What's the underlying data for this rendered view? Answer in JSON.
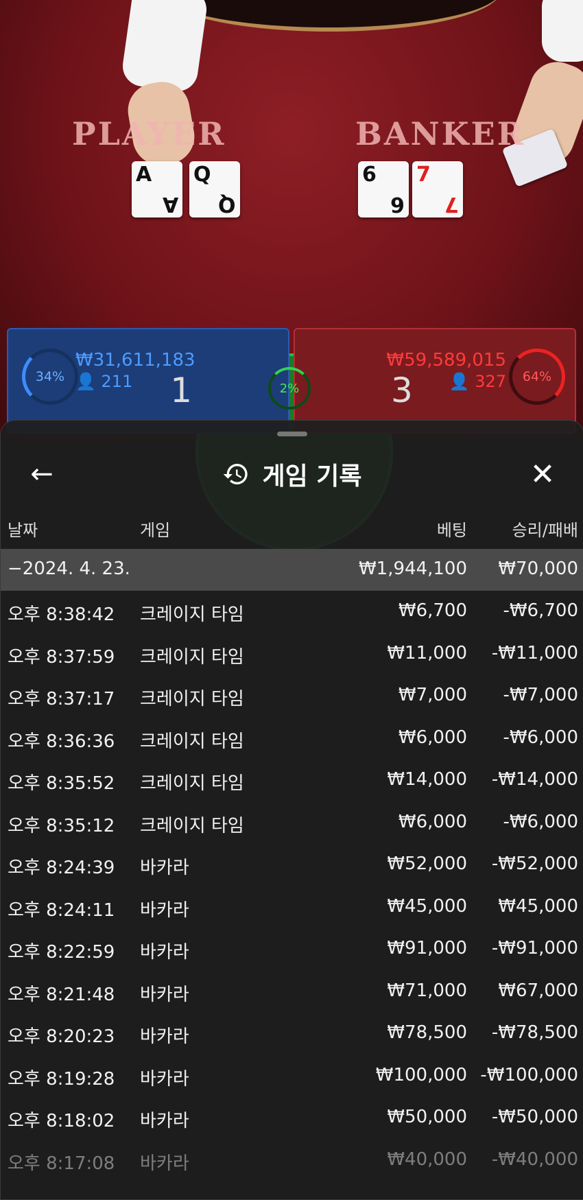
{
  "table": {
    "player_label": "PLAYER",
    "banker_label": "BANKER",
    "player_cards": [
      {
        "rank": "A",
        "suit": "♠",
        "color": "black"
      },
      {
        "rank": "Q",
        "suit": "♠",
        "color": "black"
      }
    ],
    "banker_cards": [
      {
        "rank": "6",
        "suit": "♠",
        "color": "black"
      },
      {
        "rank": "7",
        "suit": "♥",
        "color": "red"
      }
    ]
  },
  "bets": {
    "player": {
      "percent": "34%",
      "amount": "₩31,611,183",
      "count": "211",
      "score": "1"
    },
    "tie": {
      "percent": "2%"
    },
    "banker": {
      "percent": "64%",
      "amount": "₩59,589,015",
      "count": "327",
      "score": "3"
    }
  },
  "history": {
    "title": "게임 기록",
    "columns": {
      "date": "날짜",
      "game": "게임",
      "bet": "베팅",
      "winloss": "승리/패배"
    },
    "date_group": {
      "date": "−2024. 4. 23.",
      "bet": "₩1,944,100",
      "winloss": "₩70,000"
    },
    "rows": [
      {
        "time": "오후 8:38:42",
        "game": "크레이지 타임",
        "bet": "₩6,700",
        "winloss": "-₩6,700"
      },
      {
        "time": "오후 8:37:59",
        "game": "크레이지 타임",
        "bet": "₩11,000",
        "winloss": "-₩11,000"
      },
      {
        "time": "오후 8:37:17",
        "game": "크레이지 타임",
        "bet": "₩7,000",
        "winloss": "-₩7,000"
      },
      {
        "time": "오후 8:36:36",
        "game": "크레이지 타임",
        "bet": "₩6,000",
        "winloss": "-₩6,000"
      },
      {
        "time": "오후 8:35:52",
        "game": "크레이지 타임",
        "bet": "₩14,000",
        "winloss": "-₩14,000"
      },
      {
        "time": "오후 8:35:12",
        "game": "크레이지 타임",
        "bet": "₩6,000",
        "winloss": "-₩6,000"
      },
      {
        "time": "오후 8:24:39",
        "game": "바카라",
        "bet": "₩52,000",
        "winloss": "-₩52,000"
      },
      {
        "time": "오후 8:24:11",
        "game": "바카라",
        "bet": "₩45,000",
        "winloss": "₩45,000"
      },
      {
        "time": "오후 8:22:59",
        "game": "바카라",
        "bet": "₩91,000",
        "winloss": "-₩91,000"
      },
      {
        "time": "오후 8:21:48",
        "game": "바카라",
        "bet": "₩71,000",
        "winloss": "₩67,000"
      },
      {
        "time": "오후 8:20:23",
        "game": "바카라",
        "bet": "₩78,500",
        "winloss": "-₩78,500"
      },
      {
        "time": "오후 8:19:28",
        "game": "바카라",
        "bet": "₩100,000",
        "winloss": "-₩100,000"
      },
      {
        "time": "오후 8:18:02",
        "game": "바카라",
        "bet": "₩50,000",
        "winloss": "-₩50,000"
      },
      {
        "time": "오후 8:17:08",
        "game": "바카라",
        "bet": "₩40,000",
        "winloss": "-₩40,000"
      }
    ]
  },
  "icons": {
    "back": "arrow-left-icon",
    "close": "close-icon",
    "history": "history-icon"
  }
}
